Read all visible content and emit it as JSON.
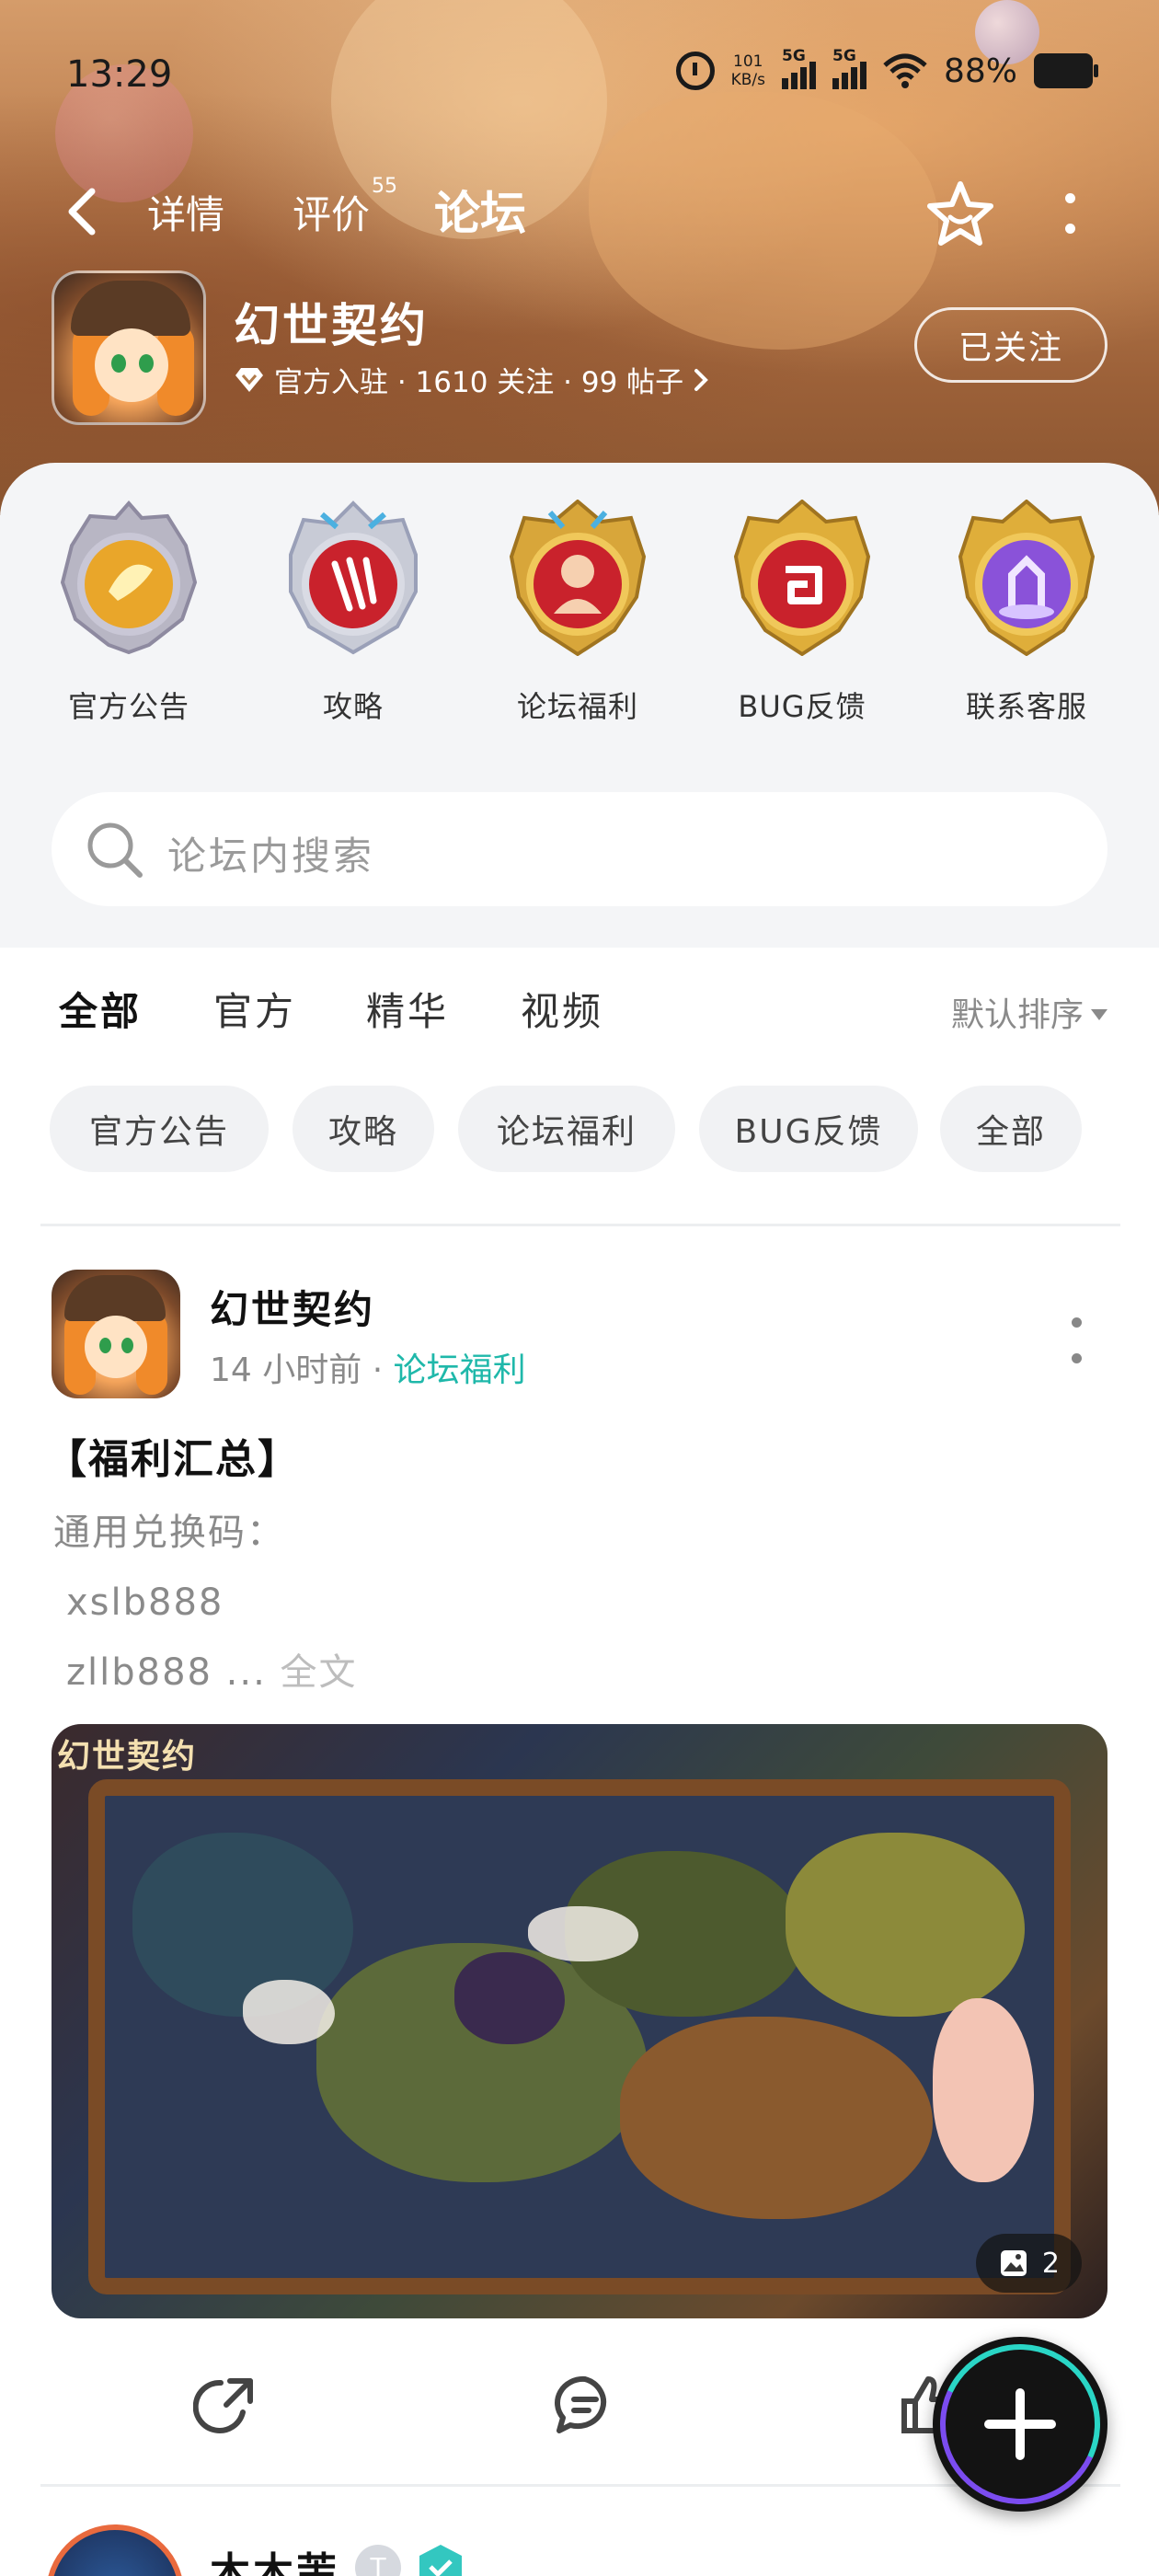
{
  "status_bar": {
    "time": "13:29",
    "net_speed_value": "101",
    "net_speed_unit": "KB/s",
    "signal1_label": "5G",
    "signal2_label": "5G",
    "battery": "88%"
  },
  "nav": {
    "tabs": [
      {
        "label": "详情"
      },
      {
        "label": "评价",
        "badge": "55"
      },
      {
        "label": "论坛",
        "active": true
      }
    ]
  },
  "game": {
    "name": "幻世契约",
    "meta": "官方入驻 · 1610 关注 · 99 帖子",
    "follow_label": "已关注"
  },
  "categories": [
    {
      "label": "官方公告",
      "color": "#f0b53a"
    },
    {
      "label": "攻略",
      "color": "#d6363f"
    },
    {
      "label": "论坛福利",
      "color": "#d9343c"
    },
    {
      "label": "BUG反馈",
      "color": "#d9343c"
    },
    {
      "label": "联系客服",
      "color": "#8a52d9"
    }
  ],
  "search": {
    "placeholder": "论坛内搜索"
  },
  "filter": {
    "tabs": [
      {
        "label": "全部",
        "active": true
      },
      {
        "label": "官方"
      },
      {
        "label": "精华"
      },
      {
        "label": "视频"
      }
    ],
    "sort_label": "默认排序"
  },
  "chips": [
    {
      "label": "官方公告"
    },
    {
      "label": "攻略"
    },
    {
      "label": "论坛福利"
    },
    {
      "label": "BUG反馈"
    },
    {
      "label": "全部"
    }
  ],
  "post": {
    "author": "幻世契约",
    "time": "14 小时前",
    "separator": "·",
    "tag": "论坛福利",
    "title": "【福利汇总】",
    "body_line1": "通用兑换码：",
    "body_line2": "xslb888",
    "body_line3": "zllb888 ...",
    "full_text_label": "全文",
    "image_logo": "幻世契约",
    "image_count": "2"
  },
  "next_post": {
    "author": "木木茉",
    "level_badge": "T"
  },
  "colors": {
    "accent": "#21d6c6",
    "tag": "#1fb8aa",
    "muted": "#8a8a8a"
  }
}
